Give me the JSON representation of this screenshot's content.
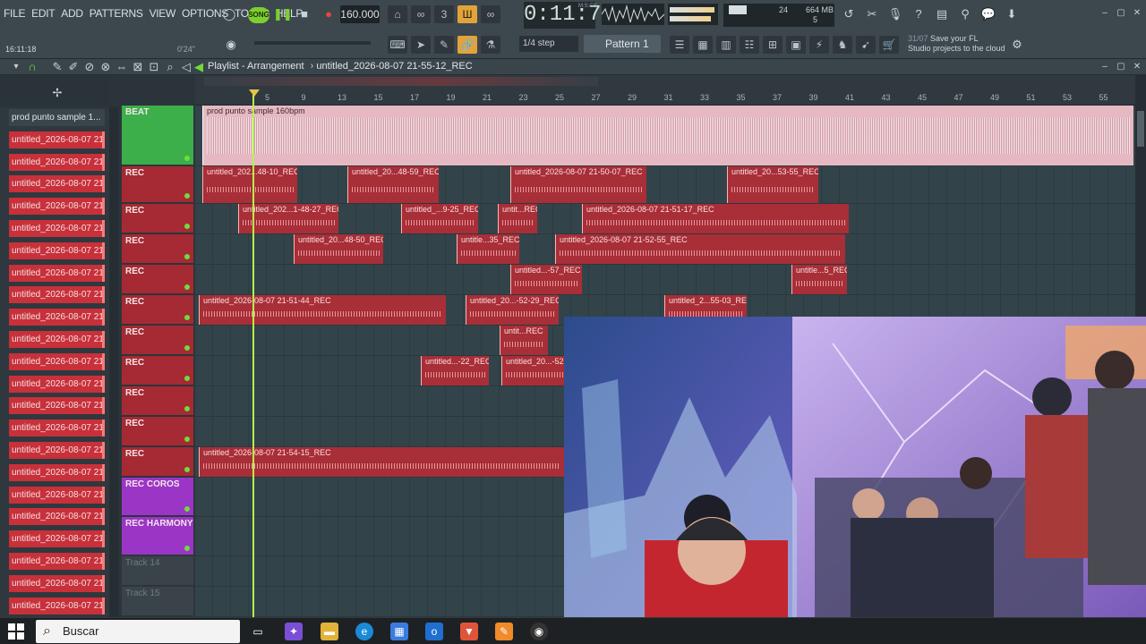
{
  "menu": [
    "FILE",
    "EDIT",
    "ADD",
    "PATTERNS",
    "VIEW",
    "OPTIONS",
    "TOOLS",
    "HELP"
  ],
  "transport": {
    "mode": "SONG",
    "tempo": "160.000",
    "time": "0:11:76",
    "time_label": "M:S:CS"
  },
  "cpu": {
    "mem": "664 MB",
    "polyphony": "24",
    "cores": "5"
  },
  "snap": "1/4 step",
  "pattern": "Pattern 1",
  "news": {
    "date": "31/07",
    "line1": "Save your FL",
    "line2": "Studio projects to the cloud"
  },
  "clock": "16:11:18",
  "hint_time": "0'24\"",
  "playlist": {
    "title": "Playlist - Arrangement",
    "project": "untitled_2026-08-07 21-55-12_REC"
  },
  "browser_items": [
    "prod punto sample 1...",
    "untitled_2026-08-07 21-...",
    "untitled_2026-08-07 21-...",
    "untitled_2026-08-07 21-...",
    "untitled_2026-08-07 21-...",
    "untitled_2026-08-07 21-...",
    "untitled_2026-08-07 21-...",
    "untitled_2026-08-07 21-...",
    "untitled_2026-08-07 21-...",
    "untitled_2026-08-07 21-...",
    "untitled_2026-08-07 21-...",
    "untitled_2026-08-07 21-...",
    "untitled_2026-08-07 21-...",
    "untitled_2026-08-07 21-...",
    "untitled_2026-08-07 21-...",
    "untitled_2026-08-07 21-...",
    "untitled_2026-08-07 21-...",
    "untitled_2026-08-07 21-...",
    "untitled_2026-08-07 21-...",
    "untitled_2026-08-07 21-...",
    "untitled_2026-08-07 21-...",
    "untitled_2026-08-07 21-...",
    "untitled_2026-08-07 21-..."
  ],
  "tracks": [
    {
      "name": "BEAT",
      "kind": "beat"
    },
    {
      "name": "REC",
      "kind": "rec"
    },
    {
      "name": "REC",
      "kind": "rec"
    },
    {
      "name": "REC",
      "kind": "rec"
    },
    {
      "name": "REC",
      "kind": "rec"
    },
    {
      "name": "REC",
      "kind": "rec"
    },
    {
      "name": "REC",
      "kind": "rec"
    },
    {
      "name": "REC",
      "kind": "rec"
    },
    {
      "name": "REC",
      "kind": "rec"
    },
    {
      "name": "REC",
      "kind": "rec"
    },
    {
      "name": "REC",
      "kind": "rec"
    },
    {
      "name": "REC COROS",
      "kind": "coros"
    },
    {
      "name": "REC HARMONY",
      "kind": "coros"
    },
    {
      "name": "Track 14",
      "kind": "empty"
    },
    {
      "name": "Track 15",
      "kind": "empty"
    }
  ],
  "ruler_ticks": [
    "5",
    "9",
    "13",
    "15",
    "17",
    "19",
    "21",
    "23",
    "25",
    "27",
    "29",
    "31",
    "33",
    "35",
    "37",
    "39",
    "41",
    "43",
    "45",
    "47",
    "49",
    "51",
    "53",
    "55"
  ],
  "clips": {
    "beat": "prod punto sample 160bpm",
    "c1": "untitled_202...48-10_REC",
    "c2": "untitled_20...48-59_REC",
    "c3": "untitled_2026-08-07 21-50-07_REC",
    "c4": "untitled_20...53-55_REC",
    "c5": "untitled_202...1-48-27_REC",
    "c6": "untitled_...9-25_REC",
    "c7": "untit...REC",
    "c8": "untitled_2026-08-07 21-51-17_REC",
    "c9": "untitled_20...48-50_REC",
    "c10": "untitle...35_REC",
    "c11": "untitled_2026-08-07 21-52-55_REC",
    "c12": "untitled...-57_REC",
    "c13": "untitle...5_REC",
    "c14": "untitled_2026-08-07 21-51-44_REC",
    "c15": "untitled_20...-52-29_REC",
    "c16": "untitled_2...55-03_REC",
    "c17": "untit...REC",
    "c18": "untitled...-22_REC",
    "c19": "untitled_20...-52",
    "c20": "untitled_2026-08-07 21-54-15_REC"
  },
  "taskbar": {
    "search_placeholder": "Buscar"
  },
  "colors": {
    "rec": "#a82e37",
    "beat": "#3cae4a",
    "coros": "#9b35c6",
    "playhead": "#b8f04a"
  }
}
